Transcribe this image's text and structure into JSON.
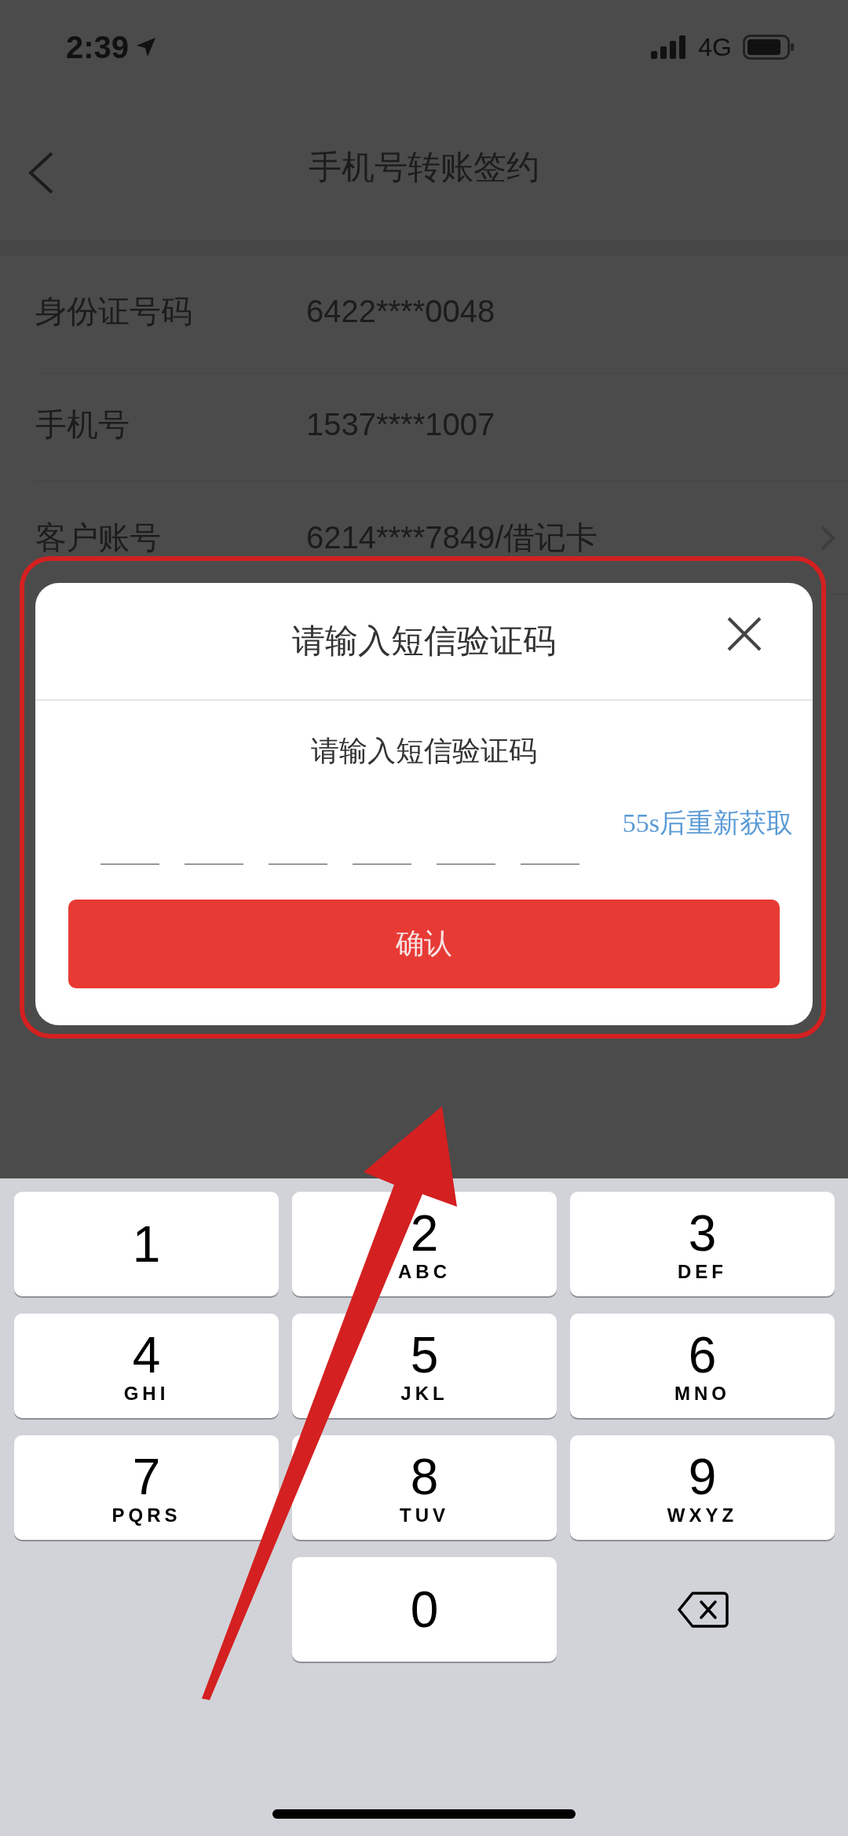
{
  "status_bar": {
    "time": "2:39",
    "network": "4G"
  },
  "nav": {
    "title": "手机号转账签约"
  },
  "rows": [
    {
      "label": "身份证号码",
      "value": "6422****0048",
      "kind": "plain"
    },
    {
      "label": "手机号",
      "value": "1537****1007",
      "kind": "plain"
    },
    {
      "label": "客户账号",
      "value": "6214****7849/借记卡",
      "kind": "link"
    }
  ],
  "dialog": {
    "title": "请输入短信验证码",
    "prompt": "请输入短信验证码",
    "code_slots": [
      {
        "filled": false
      },
      {
        "filled": false
      },
      {
        "filled": false
      },
      {
        "filled": false
      },
      {
        "filled": false
      },
      {
        "filled": false
      }
    ],
    "resend": "55s后重新获取",
    "confirm": "确认"
  },
  "keypad": [
    {
      "kind": "digit",
      "digit": "1"
    },
    {
      "kind": "digit",
      "digit": "2",
      "letters": "ABC"
    },
    {
      "kind": "digit",
      "digit": "3",
      "letters": "DEF"
    },
    {
      "kind": "digit",
      "digit": "4",
      "letters": "GHI"
    },
    {
      "kind": "digit",
      "digit": "5",
      "letters": "JKL"
    },
    {
      "kind": "digit",
      "digit": "6",
      "letters": "MNO"
    },
    {
      "kind": "digit",
      "digit": "7",
      "letters": "PQRS"
    },
    {
      "kind": "digit",
      "digit": "8",
      "letters": "TUV"
    },
    {
      "kind": "digit",
      "digit": "9",
      "letters": "WXYZ"
    },
    {
      "kind": "blank"
    },
    {
      "kind": "digit",
      "digit": "0"
    },
    {
      "kind": "delete"
    }
  ],
  "annotations": {
    "outline": true,
    "arrow": true
  }
}
